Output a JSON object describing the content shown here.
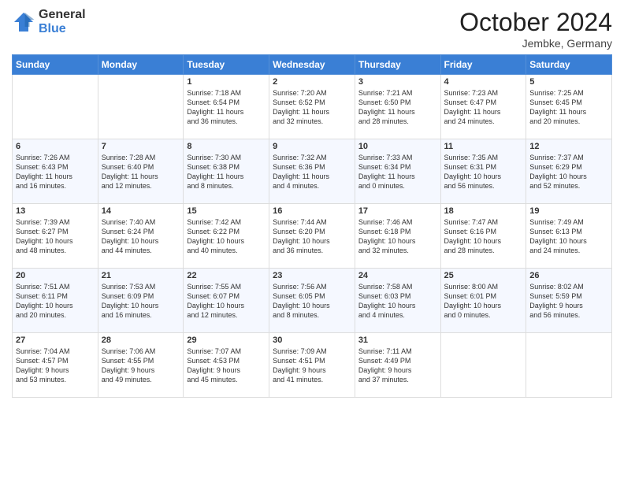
{
  "logo": {
    "general": "General",
    "blue": "Blue"
  },
  "header": {
    "month": "October 2024",
    "location": "Jembke, Germany"
  },
  "weekdays": [
    "Sunday",
    "Monday",
    "Tuesday",
    "Wednesday",
    "Thursday",
    "Friday",
    "Saturday"
  ],
  "weeks": [
    [
      {
        "day": "",
        "info": ""
      },
      {
        "day": "",
        "info": ""
      },
      {
        "day": "1",
        "info": "Sunrise: 7:18 AM\nSunset: 6:54 PM\nDaylight: 11 hours\nand 36 minutes."
      },
      {
        "day": "2",
        "info": "Sunrise: 7:20 AM\nSunset: 6:52 PM\nDaylight: 11 hours\nand 32 minutes."
      },
      {
        "day": "3",
        "info": "Sunrise: 7:21 AM\nSunset: 6:50 PM\nDaylight: 11 hours\nand 28 minutes."
      },
      {
        "day": "4",
        "info": "Sunrise: 7:23 AM\nSunset: 6:47 PM\nDaylight: 11 hours\nand 24 minutes."
      },
      {
        "day": "5",
        "info": "Sunrise: 7:25 AM\nSunset: 6:45 PM\nDaylight: 11 hours\nand 20 minutes."
      }
    ],
    [
      {
        "day": "6",
        "info": "Sunrise: 7:26 AM\nSunset: 6:43 PM\nDaylight: 11 hours\nand 16 minutes."
      },
      {
        "day": "7",
        "info": "Sunrise: 7:28 AM\nSunset: 6:40 PM\nDaylight: 11 hours\nand 12 minutes."
      },
      {
        "day": "8",
        "info": "Sunrise: 7:30 AM\nSunset: 6:38 PM\nDaylight: 11 hours\nand 8 minutes."
      },
      {
        "day": "9",
        "info": "Sunrise: 7:32 AM\nSunset: 6:36 PM\nDaylight: 11 hours\nand 4 minutes."
      },
      {
        "day": "10",
        "info": "Sunrise: 7:33 AM\nSunset: 6:34 PM\nDaylight: 11 hours\nand 0 minutes."
      },
      {
        "day": "11",
        "info": "Sunrise: 7:35 AM\nSunset: 6:31 PM\nDaylight: 10 hours\nand 56 minutes."
      },
      {
        "day": "12",
        "info": "Sunrise: 7:37 AM\nSunset: 6:29 PM\nDaylight: 10 hours\nand 52 minutes."
      }
    ],
    [
      {
        "day": "13",
        "info": "Sunrise: 7:39 AM\nSunset: 6:27 PM\nDaylight: 10 hours\nand 48 minutes."
      },
      {
        "day": "14",
        "info": "Sunrise: 7:40 AM\nSunset: 6:24 PM\nDaylight: 10 hours\nand 44 minutes."
      },
      {
        "day": "15",
        "info": "Sunrise: 7:42 AM\nSunset: 6:22 PM\nDaylight: 10 hours\nand 40 minutes."
      },
      {
        "day": "16",
        "info": "Sunrise: 7:44 AM\nSunset: 6:20 PM\nDaylight: 10 hours\nand 36 minutes."
      },
      {
        "day": "17",
        "info": "Sunrise: 7:46 AM\nSunset: 6:18 PM\nDaylight: 10 hours\nand 32 minutes."
      },
      {
        "day": "18",
        "info": "Sunrise: 7:47 AM\nSunset: 6:16 PM\nDaylight: 10 hours\nand 28 minutes."
      },
      {
        "day": "19",
        "info": "Sunrise: 7:49 AM\nSunset: 6:13 PM\nDaylight: 10 hours\nand 24 minutes."
      }
    ],
    [
      {
        "day": "20",
        "info": "Sunrise: 7:51 AM\nSunset: 6:11 PM\nDaylight: 10 hours\nand 20 minutes."
      },
      {
        "day": "21",
        "info": "Sunrise: 7:53 AM\nSunset: 6:09 PM\nDaylight: 10 hours\nand 16 minutes."
      },
      {
        "day": "22",
        "info": "Sunrise: 7:55 AM\nSunset: 6:07 PM\nDaylight: 10 hours\nand 12 minutes."
      },
      {
        "day": "23",
        "info": "Sunrise: 7:56 AM\nSunset: 6:05 PM\nDaylight: 10 hours\nand 8 minutes."
      },
      {
        "day": "24",
        "info": "Sunrise: 7:58 AM\nSunset: 6:03 PM\nDaylight: 10 hours\nand 4 minutes."
      },
      {
        "day": "25",
        "info": "Sunrise: 8:00 AM\nSunset: 6:01 PM\nDaylight: 10 hours\nand 0 minutes."
      },
      {
        "day": "26",
        "info": "Sunrise: 8:02 AM\nSunset: 5:59 PM\nDaylight: 9 hours\nand 56 minutes."
      }
    ],
    [
      {
        "day": "27",
        "info": "Sunrise: 7:04 AM\nSunset: 4:57 PM\nDaylight: 9 hours\nand 53 minutes."
      },
      {
        "day": "28",
        "info": "Sunrise: 7:06 AM\nSunset: 4:55 PM\nDaylight: 9 hours\nand 49 minutes."
      },
      {
        "day": "29",
        "info": "Sunrise: 7:07 AM\nSunset: 4:53 PM\nDaylight: 9 hours\nand 45 minutes."
      },
      {
        "day": "30",
        "info": "Sunrise: 7:09 AM\nSunset: 4:51 PM\nDaylight: 9 hours\nand 41 minutes."
      },
      {
        "day": "31",
        "info": "Sunrise: 7:11 AM\nSunset: 4:49 PM\nDaylight: 9 hours\nand 37 minutes."
      },
      {
        "day": "",
        "info": ""
      },
      {
        "day": "",
        "info": ""
      }
    ]
  ]
}
